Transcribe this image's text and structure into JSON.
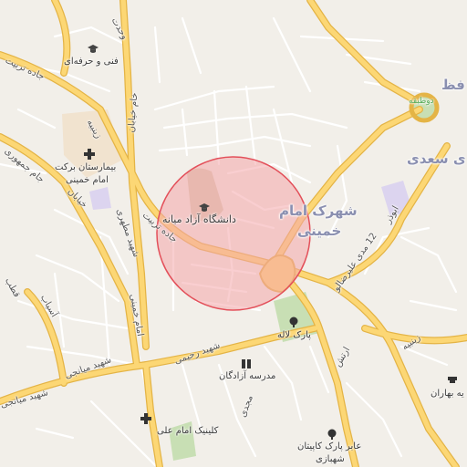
{
  "map": {
    "colors": {
      "background": "#f2efe9",
      "minor_road": "#ffffff",
      "major_road": "#fcd775",
      "major_road_casing": "#e4b446",
      "park": "#c8dfb4",
      "hospital": "#f1e3cf",
      "university": "#d9cfb6",
      "highlight_fill": "#f4a5a9",
      "highlight_stroke": "#e3505a",
      "purple_area": "#dcd4ef"
    },
    "labels": {
      "university": "دانشگاه آزاد میانه",
      "hospital_line1": "بیمارستان برکت",
      "hospital_line2": "امام خمینی",
      "technical": "فنی و حرفه‌ای",
      "park_laleh": "پارک لاله",
      "school": "مدرسه آزادگان",
      "clinic": "کلینیک امام علی",
      "park_kapitan_line1": "عابر پارک کاپیتان",
      "park_kapitan_line2": "شهبازی",
      "bahar": "یه بهاران",
      "district_imam": "شهرک امام",
      "district_imam2": "خمینی",
      "district_saadi": "ی سعدی",
      "district_top": "فظ",
      "road_tarbiat": "جاده تربیت",
      "road_tarbiat2": "جاده تربیت",
      "road_zeynabieh": "زینبیه",
      "road_zeynabieh2": "زینبیه",
      "road_imam_khomeini": "امام خمینی",
      "road_motahari": "شهید مطهری",
      "road_rahimi": "شهید رحیمی",
      "road_miyanaji": "شهید میانجی",
      "road_miyanaji2": "شهید میانجی",
      "road_jomhuri": "جام جمهوری",
      "road_alirezaei": "12 مدی علیرضالو",
      "road_abuzar": "ابوذر",
      "road_artesh": "ارتش",
      "road_mojahed": "مجدی",
      "road_kholdbarin": "خیابان",
      "road_vahdat": "وحدت",
      "road_asiyab": "آسیاب",
      "road_ghadir": "خام خیابان",
      "road_takhti": "قطب",
      "road_misc": "دوطبقه"
    }
  }
}
